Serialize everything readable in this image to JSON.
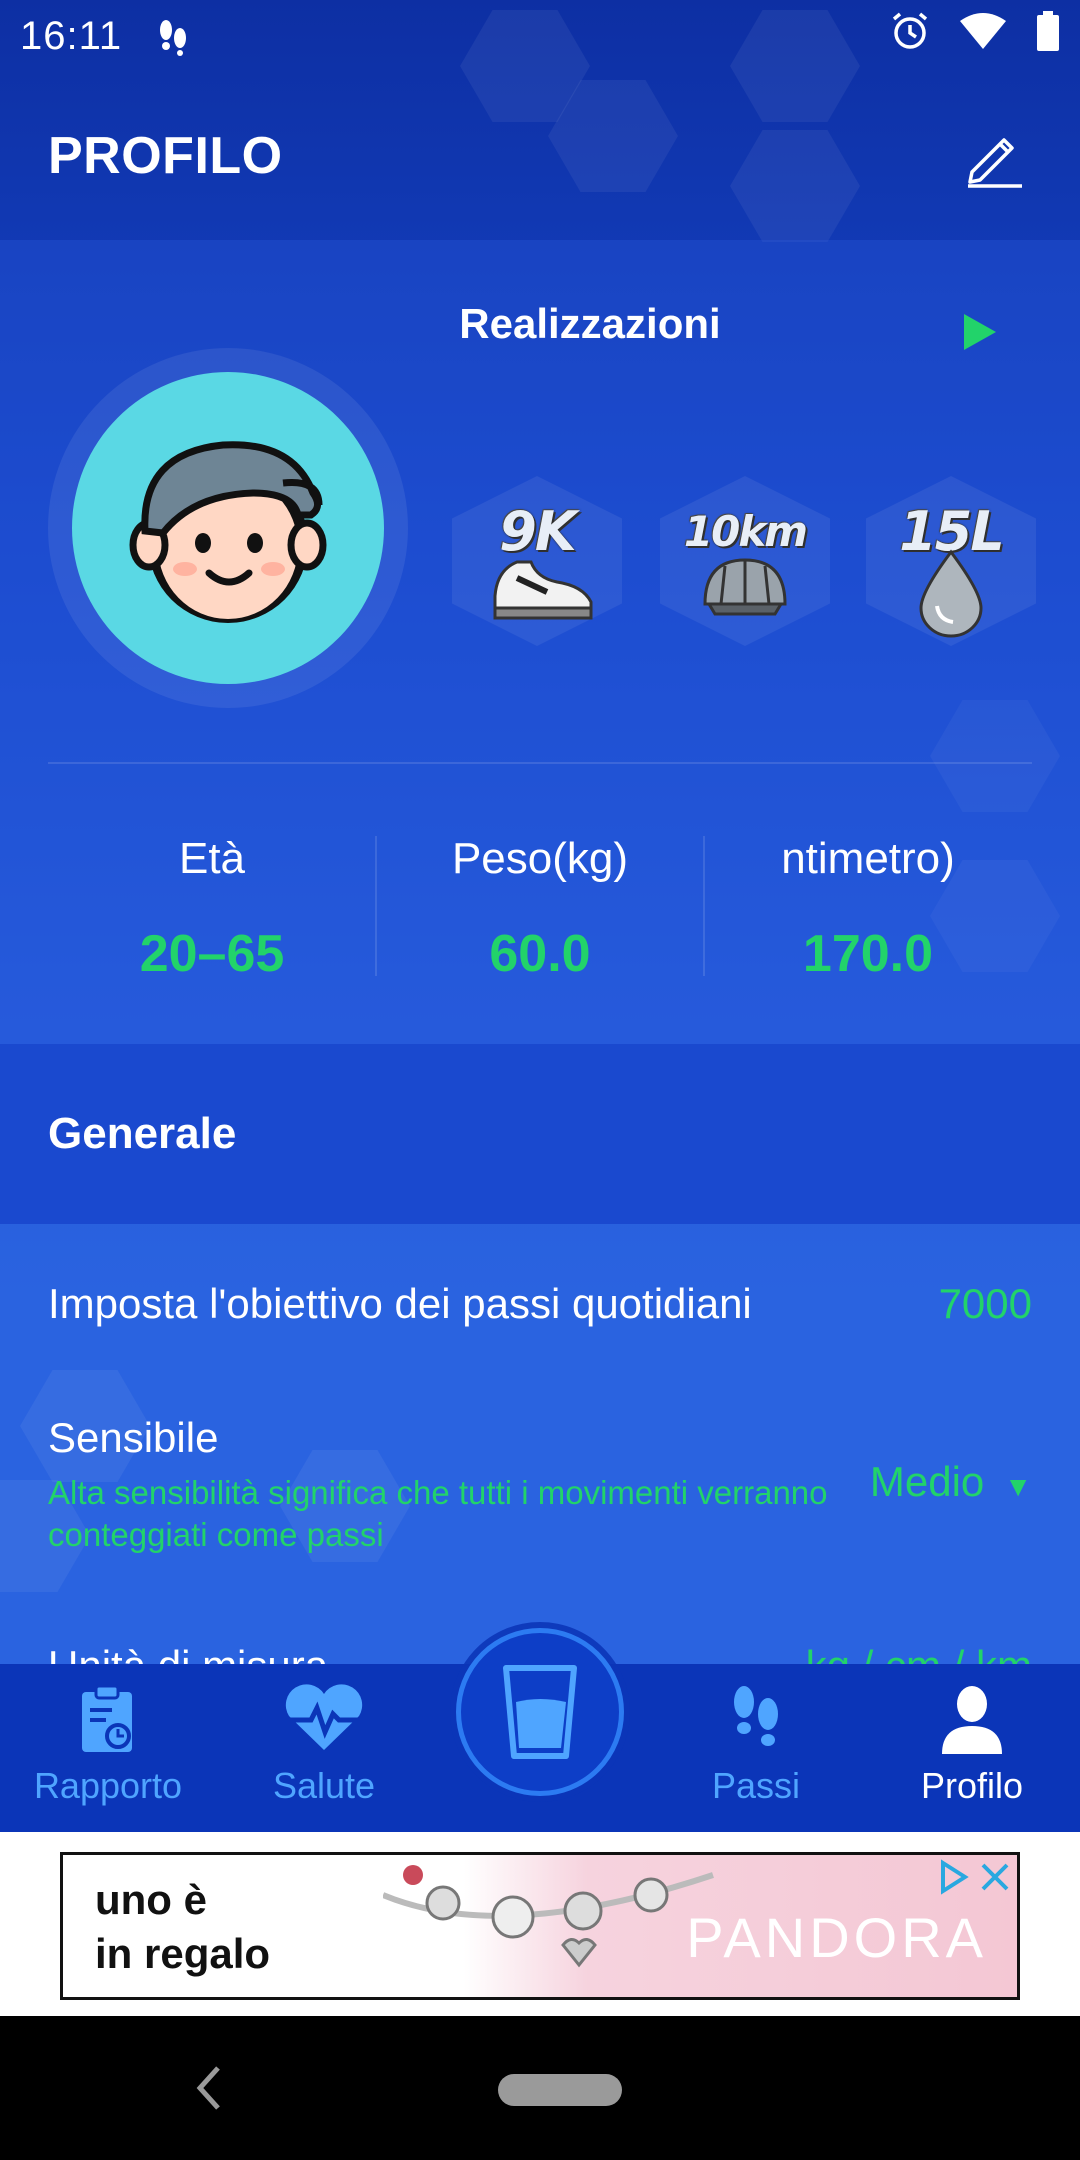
{
  "status_bar": {
    "time": "16:11"
  },
  "header": {
    "title": "PROFILO"
  },
  "achievements": {
    "title": "Realizzazioni",
    "badges": [
      {
        "label": "9K",
        "icon": "sneaker-icon"
      },
      {
        "label": "10km",
        "icon": "helmet-icon"
      },
      {
        "label": "15L",
        "icon": "water-drop-icon"
      }
    ]
  },
  "stats": [
    {
      "label": "Età",
      "value": "20–65"
    },
    {
      "label": "Peso(kg)",
      "value": "60.0"
    },
    {
      "label": "ntimetro)",
      "value": "170.0"
    }
  ],
  "section": {
    "title": "Generale"
  },
  "settings": {
    "daily_goal": {
      "label": "Imposta l'obiettivo dei passi quotidiani",
      "value": "7000"
    },
    "sensitivity": {
      "label": "Sensibile",
      "description": "Alta sensibilità significa che tutti i movimenti verranno conteggiati come passi",
      "value": "Medio"
    },
    "units": {
      "label": "Unità di misura",
      "value": "kg / cm / km"
    }
  },
  "bottom_nav": {
    "items": [
      {
        "label": "Rapporto",
        "icon": "report-icon"
      },
      {
        "label": "Salute",
        "icon": "heart-pulse-icon"
      },
      {
        "label": "Passi",
        "icon": "footsteps-icon"
      },
      {
        "label": "Profilo",
        "icon": "person-icon"
      }
    ],
    "center_icon": "water-glass-icon",
    "active": "Profilo"
  },
  "ad": {
    "line1": "uno è",
    "line2": "in regalo",
    "brand": "PANDORA"
  },
  "colors": {
    "accent_green": "#22d36a",
    "nav_blue": "#4fa5ff",
    "bg_blue": "#1a49cf"
  }
}
